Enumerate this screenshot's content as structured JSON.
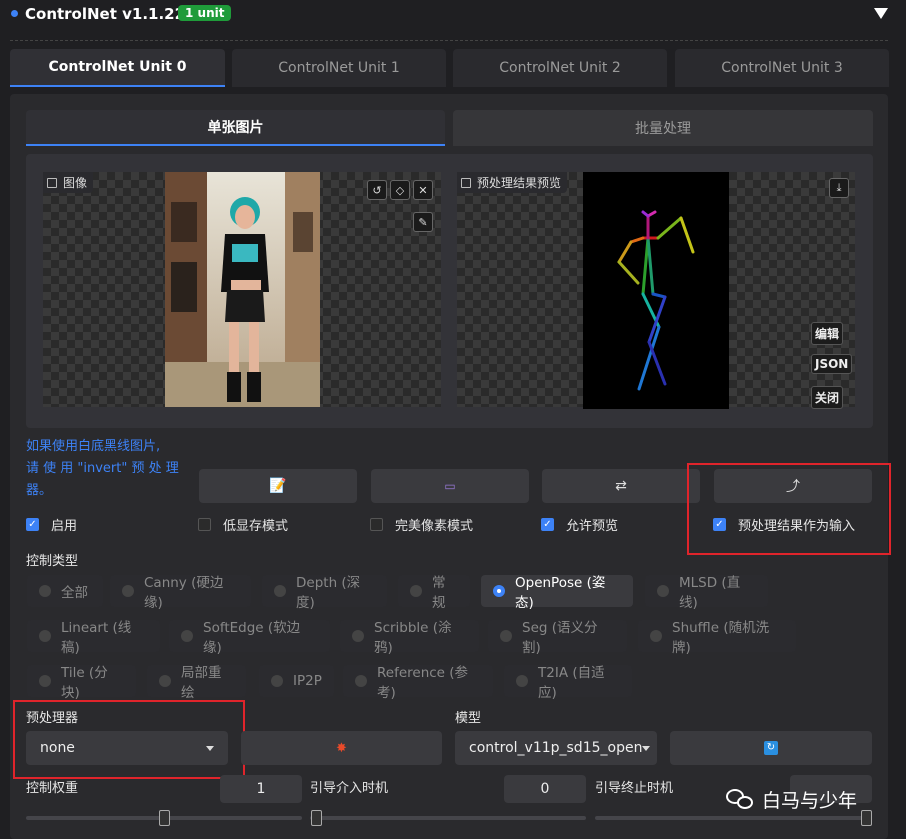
{
  "header": {
    "title": "ControlNet v1.1.228",
    "badge": "1 unit"
  },
  "unit_tabs": [
    "ControlNet Unit 0",
    "ControlNet Unit 1",
    "ControlNet Unit 2",
    "ControlNet Unit 3"
  ],
  "mode_tabs": [
    "单张图片",
    "批量处理"
  ],
  "image_panel": {
    "label": "图像"
  },
  "preview_panel": {
    "label": "预处理结果预览",
    "buttons": [
      "编辑",
      "JSON",
      "关闭"
    ]
  },
  "hint": {
    "lines": [
      "如果使用白底黑线图片,",
      "请 使 用 \"invert\" 预 处 理",
      "器。"
    ]
  },
  "checkboxes": [
    {
      "label": "启用",
      "checked": true
    },
    {
      "label": "低显存模式",
      "checked": false
    },
    {
      "label": "完美像素模式",
      "checked": false
    },
    {
      "label": "允许预览",
      "checked": true
    },
    {
      "label": "预处理结果作为输入",
      "checked": true
    }
  ],
  "control_type": {
    "label": "控制类型",
    "row1": [
      "全部",
      "Canny (硬边缘)",
      "Depth (深度)",
      "常规",
      "OpenPose (姿态)",
      "MLSD (直线)"
    ],
    "row2": [
      "Lineart (线稿)",
      "SoftEdge (软边缘)",
      "Scribble (涂鸦)",
      "Seg (语义分割)",
      "Shuffle (随机洗牌)"
    ],
    "row3": [
      "Tile (分块)",
      "局部重绘",
      "IP2P",
      "Reference (参考)",
      "T2IA (自适应)"
    ],
    "selected": "OpenPose (姿态)"
  },
  "preprocessor": {
    "label": "预处理器",
    "value": "none"
  },
  "model": {
    "label": "模型",
    "value": "control_v11p_sd15_open"
  },
  "weights": {
    "weight_label": "控制权重",
    "weight_value": "1",
    "start_label": "引导介入时机",
    "start_value": "0",
    "end_label": "引导终止时机"
  },
  "watermark": "白马与少年",
  "colors": {
    "accent": "#3d82f6",
    "badge": "#1f9b3a",
    "highlight": "#e0242b"
  }
}
